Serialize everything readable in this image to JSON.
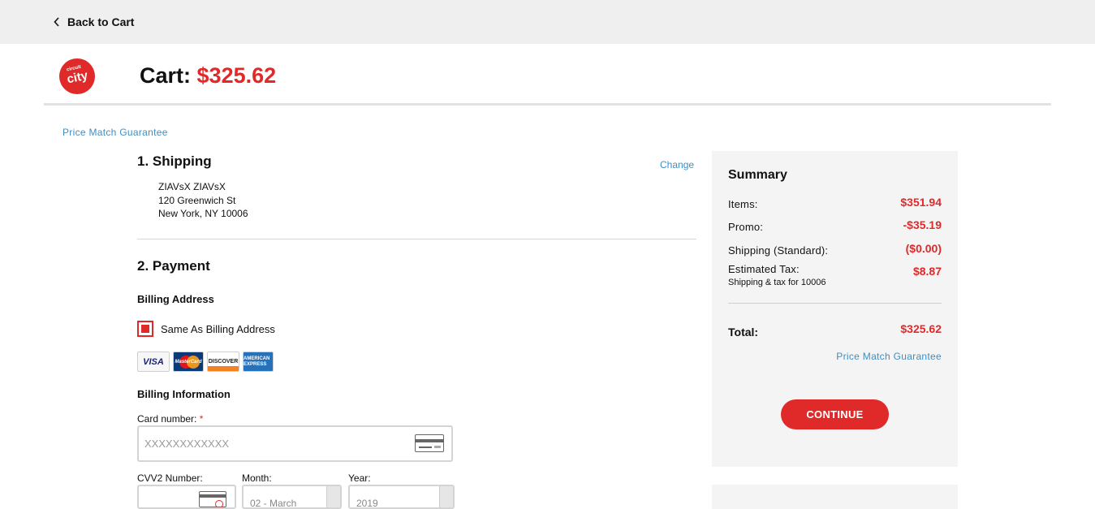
{
  "topbar": {
    "back_label": "Back to Cart"
  },
  "header": {
    "logo_text": "circuit city",
    "cart_label": "Cart:",
    "cart_total": "$325.62"
  },
  "price_match_label": "Price Match Guarantee",
  "shipping": {
    "title": "1. Shipping",
    "change_label": "Change",
    "address_lines": [
      "ZIAVsX ZIAVsX",
      "120 Greenwich St",
      "New York, NY 10006"
    ]
  },
  "payment": {
    "title": "2. Payment",
    "billing_address_label": "Billing Address",
    "same_as_billing_label": "Same As Billing Address",
    "same_as_billing_checked": true,
    "cards": [
      {
        "name": "VISA",
        "icon": "visa-icon"
      },
      {
        "name": "MasterCard",
        "icon": "mastercard-icon"
      },
      {
        "name": "DISCOVER",
        "icon": "discover-icon"
      },
      {
        "name": "AMERICAN EXPRESS",
        "icon": "amex-icon"
      }
    ],
    "billing_info_label": "Billing Information",
    "card_number_label": "Card number:",
    "required_mark": "*",
    "card_number_placeholder": "XXXXXXXXXXXX",
    "cvv_label": "CVV2 Number:",
    "month_label": "Month:",
    "month_value": "02 - March",
    "year_label": "Year:",
    "year_value": "2019"
  },
  "summary": {
    "title": "Summary",
    "rows": [
      {
        "label": "Items:",
        "value": "$351.94"
      },
      {
        "label": "Promo:",
        "value": "-$35.19"
      },
      {
        "label": "Shipping (Standard):",
        "value": "($0.00)"
      },
      {
        "label": "Estimated Tax:",
        "value": "$8.87"
      }
    ],
    "tax_note": "Shipping & tax for 10006",
    "total_label": "Total:",
    "total_value": "$325.62",
    "continue_label": "CONTINUE"
  },
  "colors": {
    "accent": "#e02a2a",
    "link": "#3d8fc4",
    "panel": "#f4f4f4"
  }
}
